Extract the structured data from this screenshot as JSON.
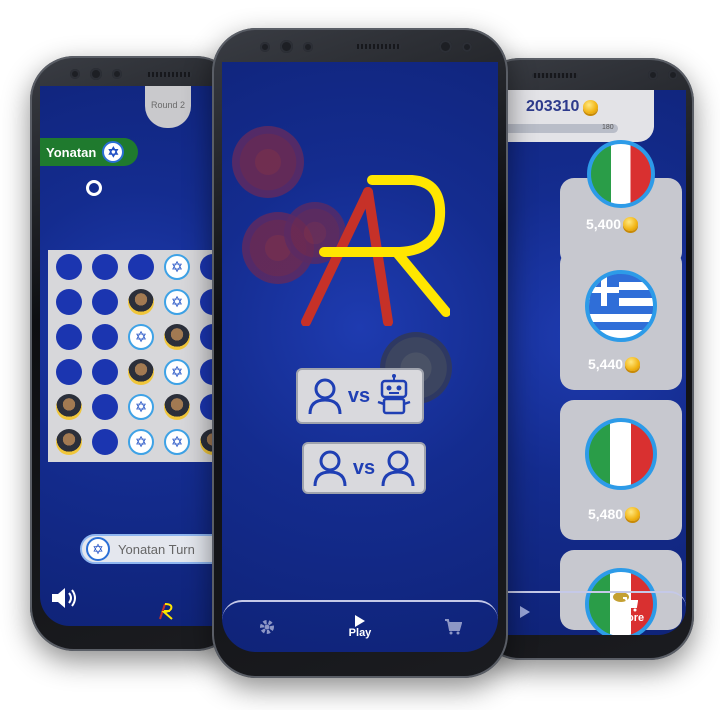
{
  "colors": {
    "screen_bg": "#142c8f",
    "logo_red": "#c63128",
    "logo_yellow": "#ffe600",
    "badge_green": "#1f7a2e",
    "coin_gold": "#f1b313"
  },
  "game_screen": {
    "round_label": "Round 2",
    "player_name": "Yonatan",
    "turn_text": "Yonatan Turn",
    "icons": [
      "star-of-david-icon",
      "speaker-icon",
      "logo-icon"
    ],
    "board": [
      [
        "empty",
        "empty",
        "empty",
        "il",
        "empty"
      ],
      [
        "empty",
        "empty",
        "av",
        "il",
        "empty"
      ],
      [
        "empty",
        "empty",
        "il",
        "av",
        "empty"
      ],
      [
        "empty",
        "empty",
        "av",
        "il",
        "empty"
      ],
      [
        "av",
        "empty",
        "il",
        "av",
        "empty"
      ],
      [
        "av",
        "empty",
        "il",
        "il",
        "av"
      ]
    ]
  },
  "menu_screen": {
    "logo_letters": "AR",
    "mode_buttons": [
      {
        "label": "vs",
        "icon": "robot-icon",
        "mode": "player-vs-computer"
      },
      {
        "label": "vs",
        "icon": "user-icon",
        "mode": "player-vs-player"
      }
    ],
    "nav": [
      {
        "label": "",
        "icon": "gear-icon"
      },
      {
        "label": "Play",
        "icon": "play-icon"
      },
      {
        "label": "",
        "icon": "cart-icon"
      }
    ]
  },
  "store_screen": {
    "coins": "203310",
    "progress_max": "180",
    "cards": [
      {
        "flag": "unknown",
        "price": "5,400"
      },
      {
        "flag": "greece",
        "price": "5,440"
      },
      {
        "flag": "italy",
        "price": "5,480"
      },
      {
        "flag": "mexico",
        "price": ""
      }
    ],
    "nav": [
      {
        "label": "",
        "icon": "play-icon"
      },
      {
        "label": "Store",
        "icon": "cart-icon"
      }
    ]
  }
}
